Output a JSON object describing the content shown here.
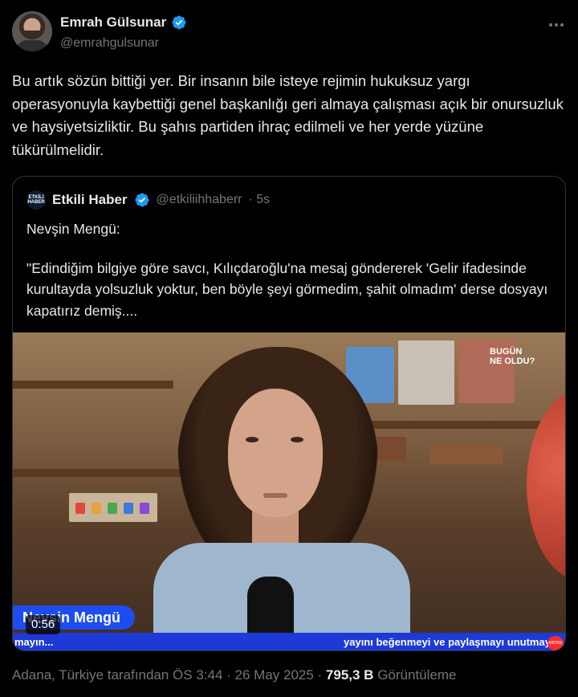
{
  "author": {
    "display_name": "Emrah Gülsunar",
    "handle": "@emrahgulsunar",
    "verified": true
  },
  "tweet": {
    "text": "Bu artık sözün bittiği yer. Bir insanın bile isteye rejimin hukuksuz yargı operasyonuyla kaybettiği genel başkanlığı geri almaya çalışması açık bir onursuzluk ve haysiyetsizliktir. Bu şahıs partiden ihraç edilmeli ve her yerde yüzüne tükürülmelidir."
  },
  "quote": {
    "avatar_text": "ETKİLİ HABER",
    "display_name": "Etkili Haber",
    "handle": "@etkiliihhaberr",
    "time": "· 5s",
    "verified": true,
    "line1": "Nevşin Mengü:",
    "line2": "\"Edindiğim bilgiye göre savcı, Kılıçdaroğlu'na mesaj göndererek 'Gelir ifadesinde kurultayda yolsuzluk yoktur, ben böyle şeyi görmedim, şahit olmadım' derse dosyayı kapatırız demiş...."
  },
  "video": {
    "name_chip": "Nevşin Mengü",
    "ticker_left": "mayın...",
    "ticker_right": "yayını beğenmeyi ve paylaşmayı unutmayın",
    "timer": "0:56",
    "logo_top": "BUGÜN",
    "logo_bottom": "NE OLDU?",
    "subscribe": "ABONE"
  },
  "meta": {
    "location_time": "Adana, Türkiye tarafından ÖS 3:44 · 26 May 2025 · ",
    "views_count": "795,3 B",
    "views_label": " Görüntüleme"
  },
  "colors": {
    "verified": "#1d9bf0",
    "text": "#e7e9ea",
    "muted": "#71767b",
    "border": "#2f3336",
    "chip": "#1d4cf0"
  }
}
